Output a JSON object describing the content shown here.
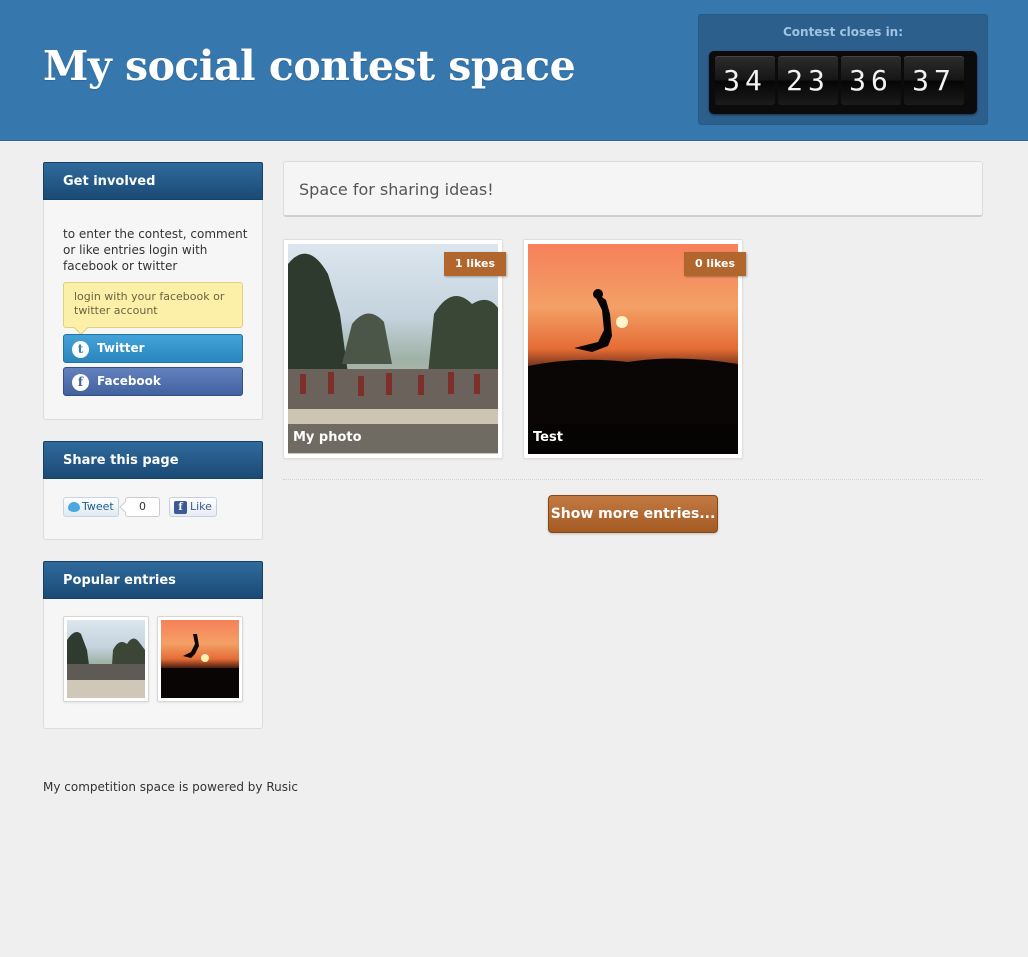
{
  "header": {
    "title": "My social contest space",
    "countdown_label": "Contest closes in:",
    "countdown": [
      "34",
      "23",
      "36",
      "37"
    ]
  },
  "get_involved": {
    "heading": "Get involved",
    "text": "to enter the contest, comment or like entries login with facebook or twitter",
    "tooltip": "login with your facebook or twitter account",
    "twitter_label": "Twitter",
    "facebook_label": "Facebook"
  },
  "share": {
    "heading": "Share this page",
    "tweet_label": "Tweet",
    "tweet_count": "0",
    "like_label": "Like"
  },
  "popular": {
    "heading": "Popular entries"
  },
  "main": {
    "banner": "Space for sharing ideas!",
    "entries": [
      {
        "caption": "My photo",
        "likes": "1 likes"
      },
      {
        "caption": "Test",
        "likes": "0 likes"
      }
    ],
    "more_label": "Show more entries..."
  },
  "footer": {
    "text": "My competition space is powered by Rusic"
  },
  "colors": {
    "header_bg": "#3677ad",
    "accent_orange": "#b0662d",
    "twitter_blue": "#2a86bd",
    "facebook_blue": "#42619f"
  },
  "icons": [
    "twitter-icon",
    "facebook-icon",
    "tweet-bird-icon",
    "facebook-like-icon"
  ]
}
